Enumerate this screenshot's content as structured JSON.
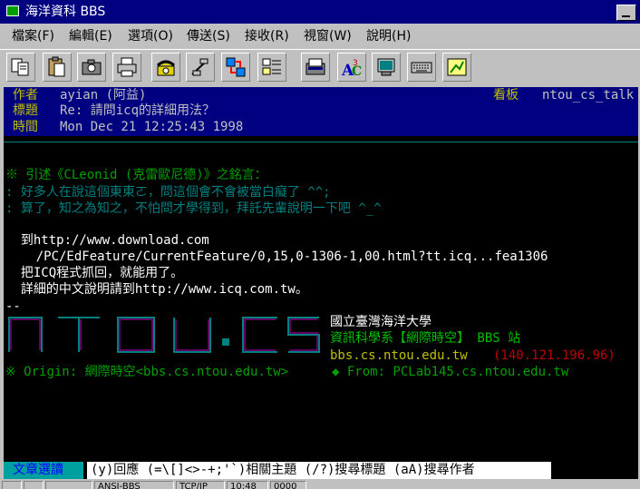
{
  "window": {
    "title": "海洋資科 BBS",
    "app_icon": "terminal-app-icon",
    "minimize_icon": "minimize-icon"
  },
  "menu": [
    {
      "label": "檔案(F)"
    },
    {
      "label": "編輯(E)"
    },
    {
      "label": "選項(O)"
    },
    {
      "label": "傳送(S)"
    },
    {
      "label": "接收(R)"
    },
    {
      "label": "視窗(W)"
    },
    {
      "label": "說明(H)"
    }
  ],
  "toolbar": [
    {
      "icon": "copy-icon"
    },
    {
      "icon": "paste-icon"
    },
    {
      "icon": "camera-icon"
    },
    {
      "icon": "print-icon"
    },
    {
      "icon": "phone-dial-icon"
    },
    {
      "icon": "hangup-icon"
    },
    {
      "icon": "connect-icon"
    },
    {
      "icon": "properties-icon"
    },
    {
      "icon": "file-transfer-icon"
    },
    {
      "icon": "font-icon"
    },
    {
      "icon": "monitor-icon"
    },
    {
      "icon": "keyboard-icon"
    },
    {
      "icon": "capture-icon"
    }
  ],
  "article": {
    "author_label": "作者",
    "author_value": "ayian (阿益)",
    "board_label": "看板",
    "board_value": "ntou_cs_talk",
    "title_label": "標題",
    "title_value": "Re: 請問icq的詳細用法？",
    "time_label": "時間",
    "time_value": "Mon Dec 21 12:25:43 1998",
    "quote_header": "※ 引述《CLeonid (克雷歐尼德)》之銘言：",
    "quote_line1": ": 好多人在說這個東東ㄛ，問這個會不會被當白癡了 ^^;",
    "quote_line2": ": 算了，知之為知之，不怕問才學得到，拜託先輩說明一下吧 ^_^",
    "body_line1": "  到http://www.download.com",
    "body_line2": "    /PC/EdFeature/CurrentFeature/0,15,0-1306-1,00.html?tt.icq...fea1306",
    "body_line3": "  把ICQ程式抓回，就能用了。",
    "body_line4": "  詳細的中文說明請到http://www.icq.com.tw。",
    "sig_separator": "--",
    "sig_logo_text": "NTOU.CS",
    "sig_univ": "國立臺灣海洋大學",
    "sig_dept": "資訊科學系【網際時空】 BBS 站",
    "sig_host": "bbs.cs.ntou.edu.tw",
    "sig_ip": "(140.121.196.96)",
    "origin_line": "※ Origin: 網際時空<bbs.cs.ntou.edu.tw>",
    "from_line": "◆ From: PCLab145.cs.ntou.edu.tw"
  },
  "status": {
    "mode": "文章選讀",
    "help": "(y)回應 (=\\[]<>-+;'`)相關主題 (/?)搜尋標題 (aA)搜尋作者"
  },
  "statusbar": {
    "emulation": "ANSI-BBS",
    "protocol": "TCP/IP",
    "time": "10:48",
    "extra": "0000"
  }
}
